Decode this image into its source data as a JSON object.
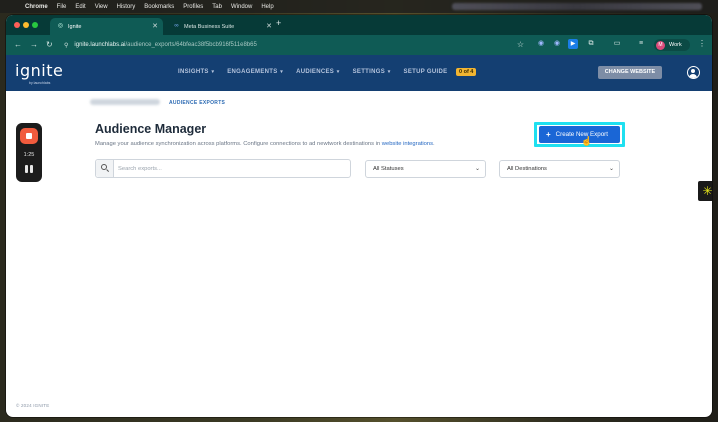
{
  "menubar": {
    "app": "Chrome",
    "items": [
      "File",
      "Edit",
      "View",
      "History",
      "Bookmarks",
      "Profiles",
      "Tab",
      "Window",
      "Help"
    ]
  },
  "browser": {
    "tabs": [
      {
        "label": "Ignite",
        "active": true
      },
      {
        "label": "Meta Business Suite",
        "active": false
      }
    ],
    "url": "ignite.launchlabs.ai",
    "url_path": "/audience_exports/64bfeac38f5bcb916f511e8b65",
    "profile_label": "Work",
    "profile_initial": "M"
  },
  "app": {
    "logo": "ignite",
    "logo_sub": "by launchlabs",
    "nav": [
      "INSIGHTS",
      "ENGAGEMENTS",
      "AUDIENCES",
      "SETTINGS",
      "SETUP GUIDE"
    ],
    "setup_badge": "0 of 4",
    "change_website": "CHANGE WEBSITE"
  },
  "page": {
    "breadcrumb": "AUDIENCE EXPORTS",
    "title": "Audience Manager",
    "subtitle": "Manage your audience synchronization across platforms. Configure connections to ad newtwork destinations in ",
    "subtitle_link": "website integrations",
    "subtitle_end": ".",
    "create_button": "Create New Export",
    "search_placeholder": "Search exports...",
    "status_filter": "All Statuses",
    "destination_filter": "All Destinations",
    "footer": "© 2024 IGNITE"
  },
  "recorder": {
    "time": "1:25"
  },
  "colors": {
    "nav_bg": "#143f72",
    "tab_bg": "#063a37",
    "primary": "#1a66d6",
    "highlight": "#1fe0f0",
    "badge": "#f2b531"
  }
}
